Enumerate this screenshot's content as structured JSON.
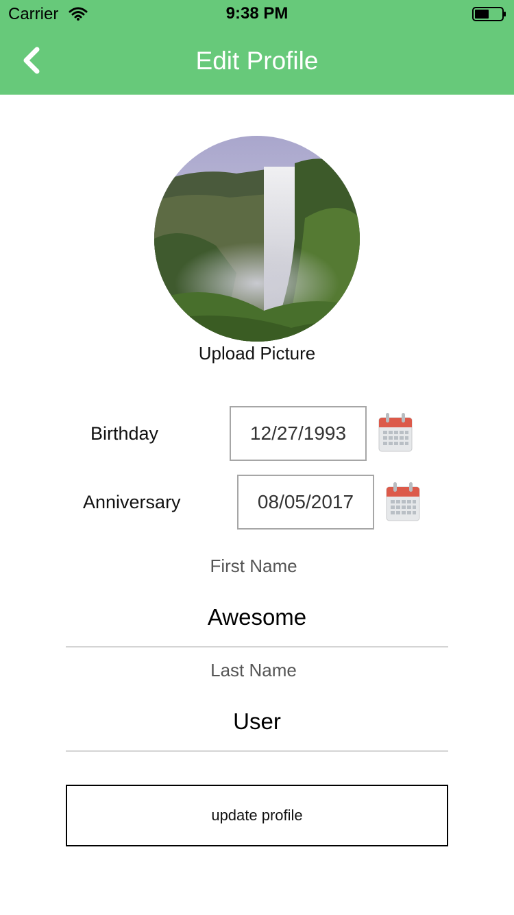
{
  "status_bar": {
    "carrier": "Carrier",
    "time": "9:38 PM"
  },
  "nav": {
    "title": "Edit Profile",
    "back_icon": "chevron-left-icon"
  },
  "profile": {
    "upload_label": "Upload Picture"
  },
  "birthday": {
    "label": "Birthday",
    "value": "12/27/1993",
    "icon": "calendar-icon"
  },
  "anniversary": {
    "label": "Anniversary",
    "value": "08/05/2017",
    "icon": "calendar-icon"
  },
  "first_name": {
    "label": "First Name",
    "value": "Awesome"
  },
  "last_name": {
    "label": "Last Name",
    "value": "User"
  },
  "actions": {
    "update_label": "update profile"
  },
  "colors": {
    "header": "#67c97a",
    "calendar_red": "#dc5a4a"
  }
}
